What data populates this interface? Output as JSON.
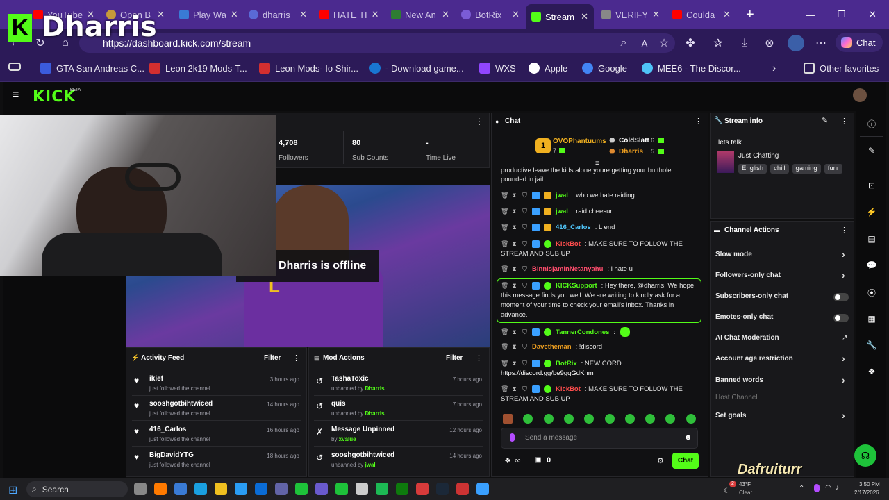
{
  "browser": {
    "tabs": [
      {
        "label": "YouTube",
        "color": "#ff0000"
      },
      {
        "label": "Open B",
        "color": "#c79a3a"
      },
      {
        "label": "Play Wa",
        "color": "#3a7bd5"
      },
      {
        "label": "dharris",
        "color": "#5a6ad6"
      },
      {
        "label": "HATE TI",
        "color": "#ff0000"
      },
      {
        "label": "New An",
        "color": "#2e7d32"
      },
      {
        "label": "BotRix",
        "color": "#7b5cd6"
      },
      {
        "label": "Stream",
        "color": "#53fc18"
      },
      {
        "label": "VERIFY",
        "color": "#888888"
      },
      {
        "label": "Coulda",
        "color": "#ff0000"
      }
    ],
    "url": "https://dashboard.kick.com/stream",
    "copilot_label": "Chat",
    "favorites": [
      {
        "label": "GTA San Andreas C...",
        "color": "#3b5bdb"
      },
      {
        "label": "Leon 2k19 Mods-T...",
        "color": "#d32f2f"
      },
      {
        "label": "Leon Mods- Io Shir...",
        "color": "#d32f2f"
      },
      {
        "label": "- Download game...",
        "color": "#1976d2"
      },
      {
        "label": "WXS",
        "color": "#9146ff"
      },
      {
        "label": "Apple",
        "color": "#ffffff"
      },
      {
        "label": "Google",
        "color": "#4285f4"
      },
      {
        "label": "MEE6 - The Discor...",
        "color": "#4fc3f7"
      }
    ],
    "other_favorites": "Other favorites"
  },
  "overlay": {
    "streamer_name": "Dharris"
  },
  "stats": [
    {
      "value": "4,708",
      "label": "Followers"
    },
    {
      "value": "80",
      "label": "Sub Counts"
    },
    {
      "value": "-",
      "label": "Time Live"
    }
  ],
  "stream": {
    "offline_text": "Dharris is offline"
  },
  "activity_feed": {
    "title": "Activity Feed",
    "filter": "Filter",
    "items": [
      {
        "name": "ikief",
        "sub": "just followed the channel",
        "time": "3 hours ago"
      },
      {
        "name": "sooshgotbihtwiced",
        "sub": "just followed the channel",
        "time": "14 hours ago"
      },
      {
        "name": "416_Carlos",
        "sub": "just followed the channel",
        "time": "16 hours ago"
      },
      {
        "name": "BigDavidYTG",
        "sub": "just followed the channel",
        "time": "18 hours ago"
      }
    ]
  },
  "mod_actions": {
    "title": "Mod Actions",
    "filter": "Filter",
    "items": [
      {
        "name": "TashaToxic",
        "sub": "unbanned by",
        "by": "Dharris",
        "time": "7 hours ago"
      },
      {
        "name": "quis",
        "sub": "unbanned by",
        "by": "Dharris",
        "time": "7 hours ago"
      },
      {
        "name": "Message Unpinned",
        "sub": "by",
        "by": "xvalue",
        "time": "12 hours ago"
      },
      {
        "name": "sooshgotbihtwiced",
        "sub": "unbanned by",
        "by": "jwal",
        "time": "14 hours ago"
      }
    ]
  },
  "chat": {
    "title": "Chat",
    "leaderboard": {
      "first": {
        "name": "OVOPhantuums",
        "count": "7",
        "rank": "1"
      },
      "second": {
        "name": "ColdSlatt",
        "count": "6"
      },
      "third": {
        "name": "Dharris",
        "count": "5"
      }
    },
    "partial_line1": "productive leave the kids alone youre getting your butthole",
    "partial_line2": "pounded in jail",
    "messages": [
      {
        "user": "jwal",
        "text": "who we hate raiding",
        "color": "#53fc18"
      },
      {
        "user": "jwal",
        "text": "raid cheesur",
        "color": "#53fc18"
      },
      {
        "user": "416_Carlos",
        "text": "L end",
        "color": "#4fc3f7"
      },
      {
        "user": "KickBot",
        "text": "MAKE SURE TO FOLLOW THE",
        "text2": "STREAM AND SUB UP",
        "color": "#ff4d4d"
      },
      {
        "user": "BinnisjaminNetanyahu",
        "text": "i hate u",
        "color": "#ff4d6d"
      },
      {
        "user": "KICKSupport",
        "text": "Hey there, @dharris! We hope",
        "text2": "this message finds you well. We are writing to kindly ask for a",
        "text3": "moment of your time to check your email's inbox. Thanks in",
        "text4": "advance.",
        "color": "#53fc18"
      },
      {
        "user": "TannerCondones",
        "text": "",
        "color": "#53fc18"
      },
      {
        "user": "Davetheman",
        "text": "!discord",
        "color": "#f0a020"
      },
      {
        "user": "BotRix",
        "text": "NEW CORD",
        "text2": "https://discord.gg/be9gqGdKnm",
        "color": "#53fc18"
      },
      {
        "user": "KickBot",
        "text": "MAKE SURE TO FOLLOW THE",
        "text2": "STREAM AND SUB UP",
        "color": "#ff4d4d"
      }
    ],
    "input_placeholder": "Send a message",
    "viewer_count": "0",
    "send_label": "Chat"
  },
  "stream_info": {
    "title": "Stream info",
    "stream_title": "lets talk",
    "category": "Just Chatting",
    "tags": [
      "English",
      "chill",
      "gaming",
      "funr"
    ]
  },
  "channel_actions": {
    "title": "Channel Actions",
    "items": [
      {
        "label": "Slow mode",
        "kind": "chevron"
      },
      {
        "label": "Followers-only chat",
        "kind": "chevron"
      },
      {
        "label": "Subscribers-only chat",
        "kind": "toggle"
      },
      {
        "label": "Emotes-only chat",
        "kind": "toggle"
      },
      {
        "label": "AI Chat Moderation",
        "kind": "link"
      },
      {
        "label": "Account age restriction",
        "kind": "chevron"
      },
      {
        "label": "Banned words",
        "kind": "chevron"
      },
      {
        "label": "Host Channel",
        "kind": "disabled"
      },
      {
        "label": "Set goals",
        "kind": "chevron"
      }
    ]
  },
  "taskbar": {
    "search": "Search",
    "weather_temp": "43°F",
    "weather_cond": "Clear",
    "weather_badge": "2",
    "time": "3:50 PM",
    "date": "2/17/2026",
    "watermark": "Dafruiturr"
  }
}
